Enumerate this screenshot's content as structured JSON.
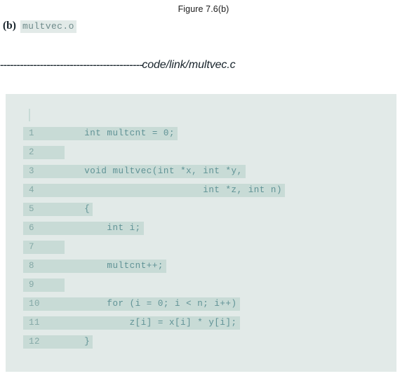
{
  "figure": {
    "title": "Figure 7.6(b)"
  },
  "subcaption": {
    "label": "(b)",
    "object_file": "multvec.o"
  },
  "rule": {
    "dashes": "-------------------------------------------",
    "path": "code/link/multvec.c"
  },
  "colors": {
    "panel_background": "#e2eae8",
    "line_highlight": "#c8dbd6",
    "code_text": "#5f9295",
    "line_number": "#84a8a6",
    "heading_text": "#17232b",
    "page_background": "#ffffff"
  },
  "code_panel": {
    "caret_visible": true,
    "lines": [
      {
        "number": "1",
        "text": "    int multcnt = 0;"
      },
      {
        "number": "2",
        "text": ""
      },
      {
        "number": "3",
        "text": "    void multvec(int *x, int *y,"
      },
      {
        "number": "4",
        "text": "                         int *z, int n)"
      },
      {
        "number": "5",
        "text": "    {"
      },
      {
        "number": "6",
        "text": "        int i;"
      },
      {
        "number": "7",
        "text": ""
      },
      {
        "number": "8",
        "text": "        multcnt++;"
      },
      {
        "number": "9",
        "text": ""
      },
      {
        "number": "10",
        "text": "        for (i = 0; i < n; i++)"
      },
      {
        "number": "11",
        "text": "            z[i] = x[i] * y[i];"
      },
      {
        "number": "12",
        "text": "    }"
      }
    ]
  }
}
